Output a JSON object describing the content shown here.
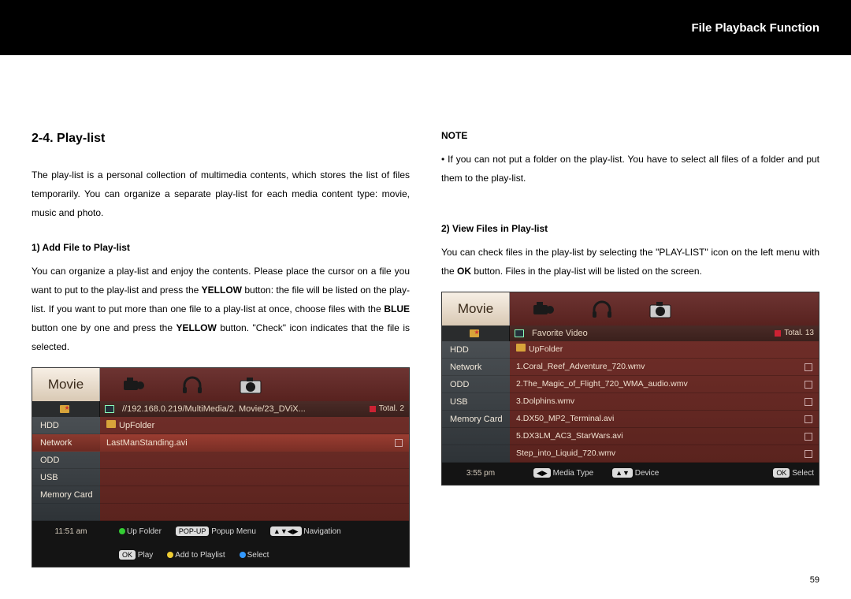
{
  "header": {
    "title": "File Playback Function"
  },
  "pageNumber": "59",
  "left": {
    "heading": "2-4. Play-list",
    "intro": "The play-list is a personal collection of multimedia contents, which stores the list of files temporarily. You can organize a separate play-list for each media content type: movie, music and photo.",
    "sub1": "1) Add File to Play-list",
    "p1a": "You can organize a play-list and enjoy the contents. Please place the cursor on a file you want to put to the play-list and press the ",
    "p1b": "YELLOW",
    "p1c": " button: the file will be listed on the play-list. If you want to put more than one file to a play-list at once, choose files with the ",
    "p1d": "BLUE",
    "p1e": " button one by one and press the ",
    "p1f": "YELLOW",
    "p1g": " button. \"Check\" icon indicates that the file is selected."
  },
  "right": {
    "noteLabel": "NOTE",
    "noteBullet": "• ",
    "noteText": "If you can not put a folder on the play-list. You have to select all files of a folder and put them to the play-list.",
    "sub2": "2) View Files in Play-list",
    "p2a": "You can check files in the play-list by selecting the \"PLAY-LIST\" icon on the left menu with the ",
    "p2b": "OK",
    "p2c": " button. Files in the play-list will be listed on the screen."
  },
  "shot1": {
    "tab": "Movie",
    "path": "//192.168.0.219/MultiMedia/2. Movie/23_DViX...",
    "total": "Total. 2",
    "side": [
      "HDD",
      "Network",
      "ODD",
      "USB",
      "Memory Card"
    ],
    "sideSelected": 1,
    "files": [
      "UpFolder",
      "LastManStanding.avi"
    ],
    "fileSelected": 1,
    "clock": "11:51 am",
    "foot": {
      "upfolder": "Up Folder",
      "popup": "Popup Menu",
      "nav": "Navigation",
      "play": "Play",
      "add": "Add to Playlist",
      "select": "Select",
      "popPill": "POP-UP",
      "okPill": "OK",
      "navPill": "▲▼◀▶"
    }
  },
  "shot2": {
    "tab": "Movie",
    "fav": "Favorite Video",
    "total": "Total. 13",
    "side": [
      "HDD",
      "Network",
      "ODD",
      "USB",
      "Memory Card"
    ],
    "files": [
      "UpFolder",
      "1.Coral_Reef_Adventure_720.wmv",
      "2.The_Magic_of_Flight_720_WMA_audio.wmv",
      "3.Dolphins.wmv",
      "4.DX50_MP2_Terminal.avi",
      "5.DX3LM_AC3_StarWars.avi",
      "Step_into_Liquid_720.wmv"
    ],
    "clock": "3:55 pm",
    "foot": {
      "media": "Media Type",
      "device": "Device",
      "select": "Select",
      "lrPill": "◀▶",
      "udPill": "▲▼",
      "okPill": "OK"
    }
  }
}
